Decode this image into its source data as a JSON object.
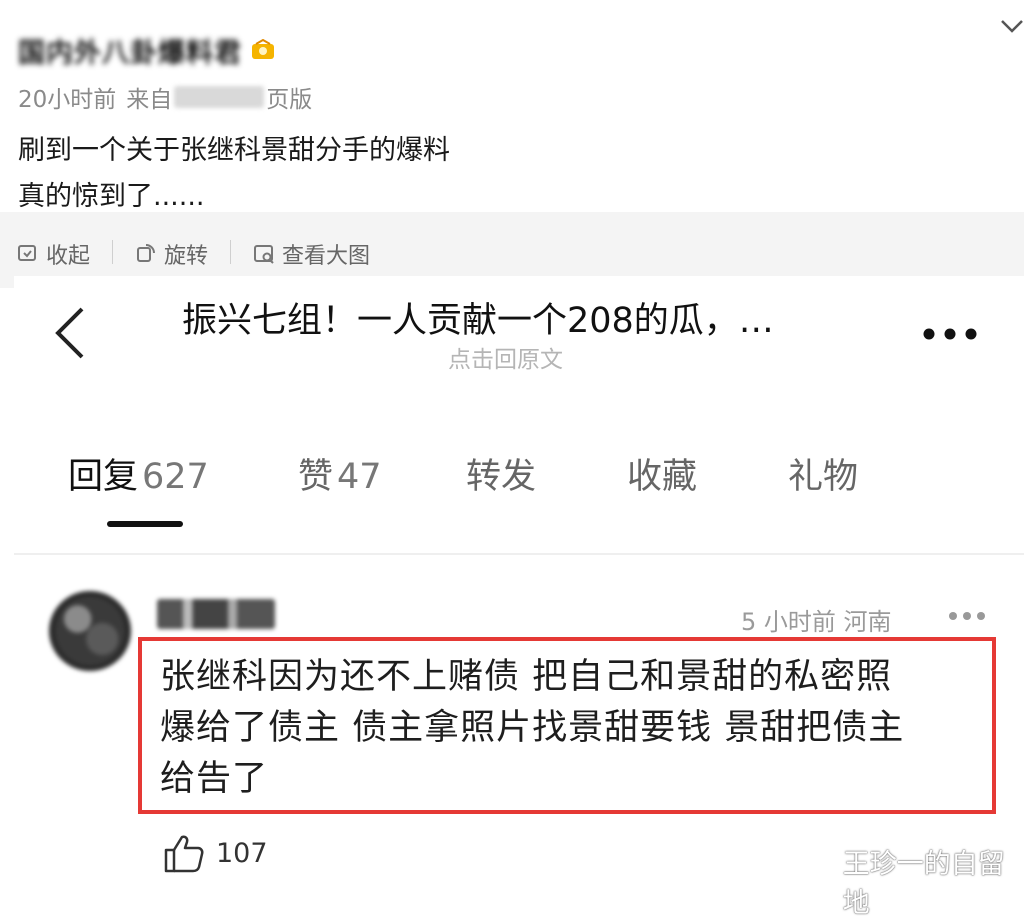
{
  "post": {
    "author_name": "国内外八卦爆料君",
    "time": "20小时前",
    "source_prefix": "来自",
    "source_suffix": "页版",
    "text_line1": "刷到一个关于张继科景甜分手的爆料",
    "text_line2": "真的惊到了......"
  },
  "image_actions": {
    "collapse": "收起",
    "rotate": "旋转",
    "view_large": "查看大图"
  },
  "thread": {
    "title": "振兴七组！一人贡献一个208的瓜，…",
    "back_to_post": "点击回原文"
  },
  "tabs": [
    {
      "label": "回复",
      "count": "627"
    },
    {
      "label": "赞",
      "count": "47"
    },
    {
      "label": "转发",
      "count": ""
    },
    {
      "label": "收藏",
      "count": ""
    },
    {
      "label": "礼物",
      "count": ""
    }
  ],
  "comment": {
    "meta": "5 小时前 河南",
    "line1": "张继科因为还不上赌债 把自己和景甜的私密照",
    "line2": "爆给了债主 债主拿照片找景甜要钱 景甜把债主",
    "line3": "给告了",
    "likes": "107"
  },
  "watermark": "王珍一的自留地",
  "colors": {
    "highlight": "#e53935",
    "action_bar_bg": "#f4f4f4",
    "badge": "#f5b400"
  }
}
